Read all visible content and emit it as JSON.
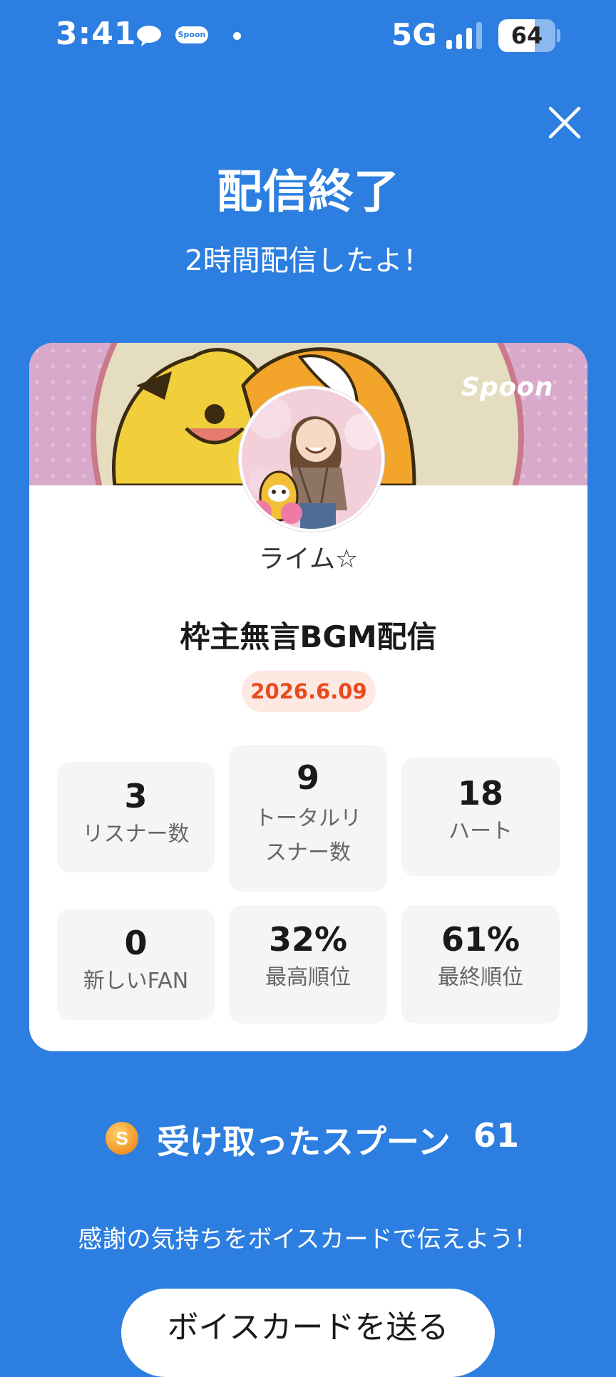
{
  "status_bar": {
    "time": "3:41",
    "spoon_badge": "Spoon",
    "network": "5G",
    "battery": "64",
    "battery_fraction": 0.64
  },
  "header": {
    "title": "配信終了",
    "subtitle": "2時間配信したよ！"
  },
  "card": {
    "brand": "Spoon",
    "username": "ライム☆",
    "stream_title": "枠主無言BGM配信",
    "date": "2026.6.09",
    "stats": [
      {
        "value": "3",
        "label": "リスナー数"
      },
      {
        "value": "9",
        "label": "トータルリスナー数"
      },
      {
        "value": "18",
        "label": "ハート"
      },
      {
        "value": "0",
        "label": "新しいFAN"
      },
      {
        "value": "32%",
        "label": "最高順位"
      },
      {
        "value": "61%",
        "label": "最終順位"
      }
    ]
  },
  "spoons": {
    "coin_letter": "S",
    "label": "受け取ったスプーン",
    "count": "61"
  },
  "footer": {
    "message": "感謝の気持ちをボイスカードで伝えよう！",
    "button_label": "ボイスカードを送る"
  },
  "colors": {
    "background": "#2c7ee0",
    "date_text": "#e84a1c",
    "date_bg": "#fde8e2",
    "stat_bg": "#f5f5f5",
    "coin": "#f5a623"
  }
}
